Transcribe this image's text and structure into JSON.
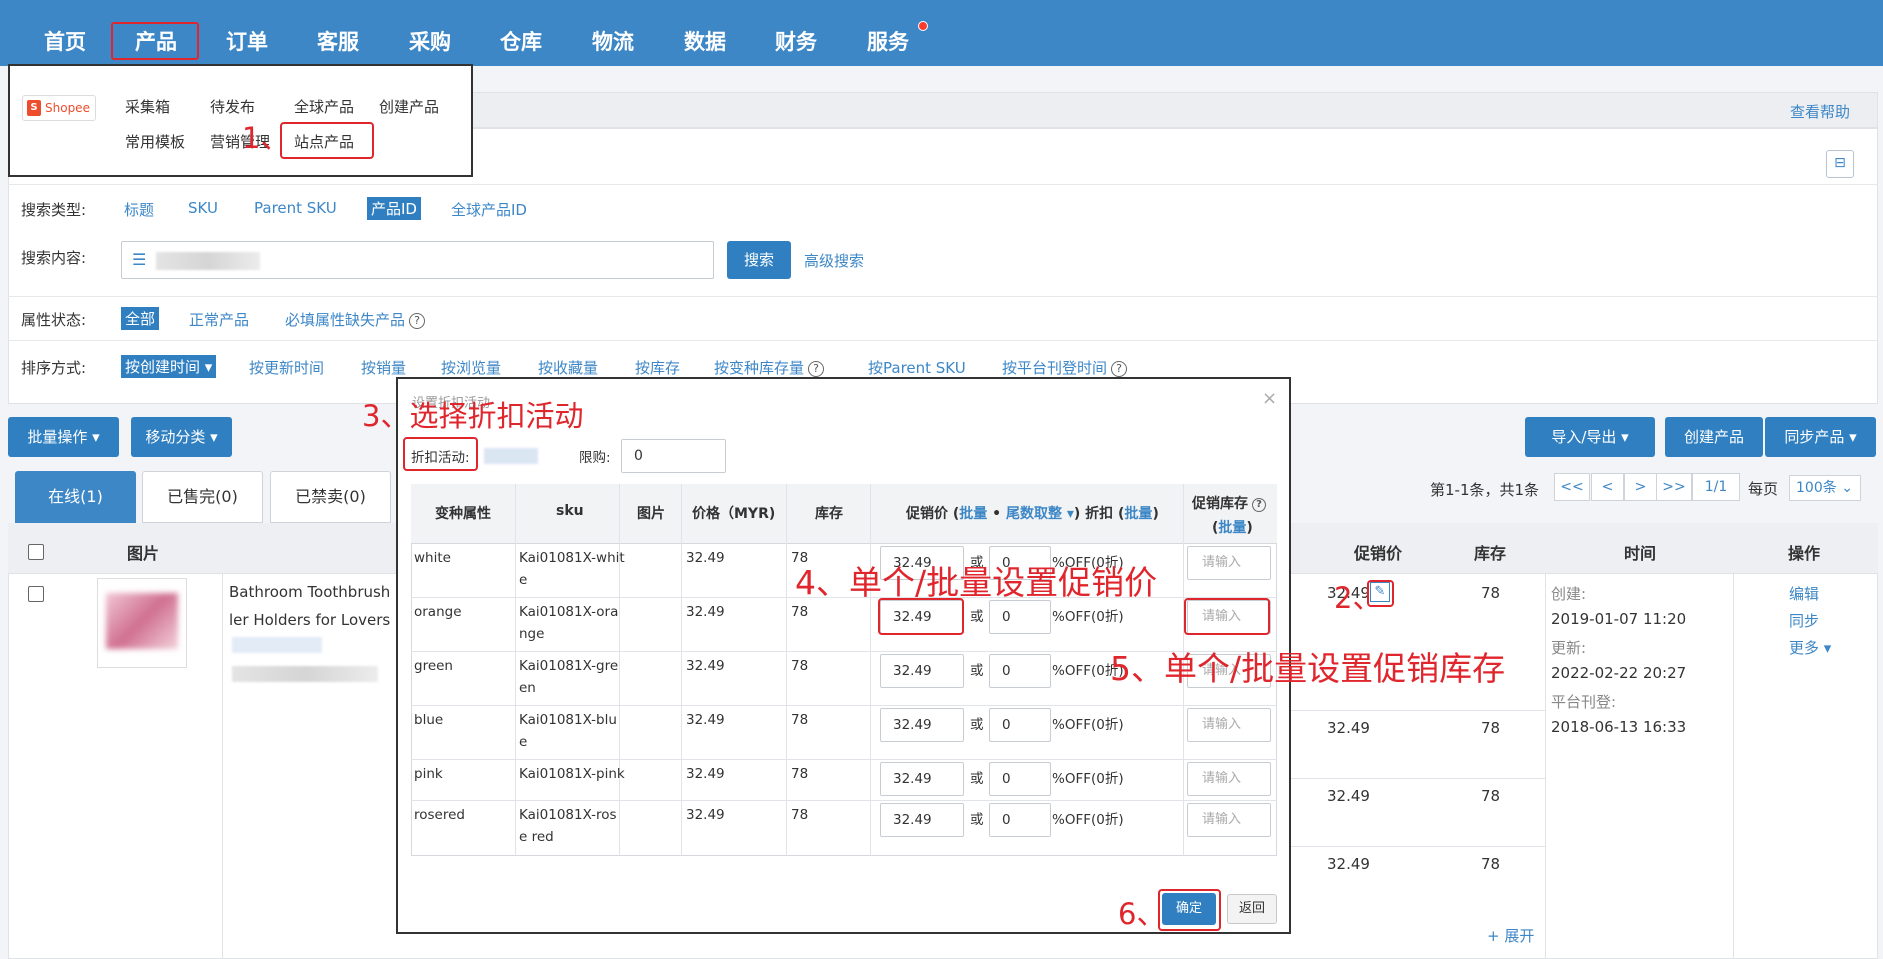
{
  "nav": {
    "items": [
      "首页",
      "产品",
      "订单",
      "客服",
      "采购",
      "仓库",
      "物流",
      "数据",
      "财务",
      "服务"
    ]
  },
  "platform_menu": {
    "logo": "Shopee",
    "row1": [
      "采集箱",
      "待发布",
      "全球产品",
      "创建产品"
    ],
    "row2": [
      "常用模板",
      "营销管理",
      "站点产品"
    ]
  },
  "help_link": "查看帮助",
  "collapse_icon": "collapse-icon",
  "search": {
    "type_label": "搜索类型:",
    "types": [
      "标题",
      "SKU",
      "Parent SKU",
      "产品ID",
      "全球产品ID"
    ],
    "content_label": "搜索内容:",
    "search_button": "搜索",
    "advanced_link": "高级搜索"
  },
  "attr": {
    "label": "属性状态:",
    "options": [
      "全部",
      "正常产品",
      "必填属性缺失产品"
    ]
  },
  "sort": {
    "label": "排序方式:",
    "options": [
      "按创建时间",
      "按更新时间",
      "按销量",
      "按浏览量",
      "按收藏量",
      "按库存",
      "按变种库存量",
      "按Parent SKU",
      "按平台刊登时间"
    ]
  },
  "toolbar": {
    "bulk": "批量操作",
    "move": "移动分类",
    "import_export": "导入/导出",
    "create": "创建产品",
    "sync": "同步产品"
  },
  "tabs": [
    "在线(1)",
    "已售完(0)",
    "已禁卖(0)"
  ],
  "pagination": {
    "summary": "第1-1条，共1条",
    "first": "<<",
    "prev": "<",
    "next": ">",
    "last": ">>",
    "page": "1/1",
    "per_page_label": "每页",
    "per_page_value": "100条"
  },
  "table": {
    "headers": {
      "image": "图片",
      "promo_price": "促销价",
      "stock": "库存",
      "time": "时间",
      "actions": "操作"
    },
    "product_title_line1": "Bathroom Toothbrush H",
    "product_title_line2": "ler Holders for Lovers",
    "rows": [
      {
        "promo": "32.49",
        "stock": "78"
      },
      {
        "promo": "32.49",
        "stock": "78"
      },
      {
        "promo": "32.49",
        "stock": "78"
      },
      {
        "promo": "32.49",
        "stock": "78"
      }
    ],
    "time": {
      "created_label": "创建:",
      "created": "2019-01-07 11:20",
      "updated_label": "更新:",
      "updated": "2022-02-22 20:27",
      "listed_label": "平台刊登:",
      "listed": "2018-06-13 16:33"
    },
    "actions": [
      "编辑",
      "同步",
      "更多"
    ],
    "expand": "+ 展开",
    "edit_icon": "edit-icon"
  },
  "modal": {
    "close": "×",
    "title_ghost": "设置折扣活动",
    "activity_label": "折扣活动:",
    "limit_label": "限购:",
    "limit_value": "0",
    "headers": {
      "variant": "变种属性",
      "sku": "sku",
      "image": "图片",
      "price": "价格（MYR)",
      "stock": "库存",
      "promo_prefix": "促销价 (",
      "bulk": "批量",
      "dot": " • ",
      "rounding": "尾数取整",
      "promo_mid": ")  折扣 (",
      "bulk2": "批量",
      "close_paren": ")",
      "promo_stock": "促销库存",
      "bulk3": "批量"
    },
    "rows": [
      {
        "variant": "white",
        "sku1": "Kai01081X-whit",
        "sku2": "e",
        "price": "32.49",
        "stock": "78",
        "promo": "32.49",
        "disc": "0"
      },
      {
        "variant": "orange",
        "sku1": "Kai01081X-ora",
        "sku2": "nge",
        "price": "32.49",
        "stock": "78",
        "promo": "32.49",
        "disc": "0"
      },
      {
        "variant": "green",
        "sku1": "Kai01081X-gre",
        "sku2": "en",
        "price": "32.49",
        "stock": "78",
        "promo": "32.49",
        "disc": "0"
      },
      {
        "variant": "blue",
        "sku1": "Kai01081X-blu",
        "sku2": "e",
        "price": "32.49",
        "stock": "78",
        "promo": "32.49",
        "disc": "0"
      },
      {
        "variant": "pink",
        "sku1": "Kai01081X-pink",
        "sku2": "",
        "price": "32.49",
        "stock": "78",
        "promo": "32.49",
        "disc": "0"
      },
      {
        "variant": "rosered",
        "sku1": "Kai01081X-ros",
        "sku2": "e red",
        "price": "32.49",
        "stock": "78",
        "promo": "32.49",
        "disc": "0"
      }
    ],
    "or": "或",
    "off": "%OFF(0折)",
    "stock_placeholder": "请输入",
    "confirm": "确定",
    "back": "返回"
  },
  "annotations": {
    "a1": "1、",
    "a2": "2、",
    "a3": "3、选择折扣活动",
    "a4": "4、单个/批量设置促销价",
    "a5": "5、单个/批量设置促销库存",
    "a6": "6、"
  },
  "colors": {
    "nav": "#3d87c7",
    "accent": "#2f7fc1",
    "annotation": "#e0262d"
  }
}
